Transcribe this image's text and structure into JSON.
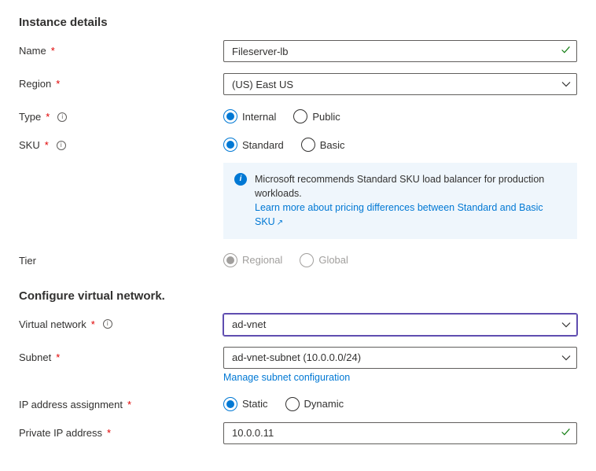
{
  "sections": {
    "instance": "Instance details",
    "vnet": "Configure virtual network."
  },
  "labels": {
    "name": "Name",
    "region": "Region",
    "type": "Type",
    "sku": "SKU",
    "tier": "Tier",
    "virtual_network": "Virtual network",
    "subnet": "Subnet",
    "ip_assignment": "IP address assignment",
    "private_ip": "Private IP address"
  },
  "values": {
    "name": "Fileserver-lb",
    "region": "(US) East US",
    "virtual_network": "ad-vnet",
    "subnet": "ad-vnet-subnet (10.0.0.0/24)",
    "private_ip": "10.0.0.11"
  },
  "radios": {
    "type": {
      "internal": "Internal",
      "public": "Public"
    },
    "sku": {
      "standard": "Standard",
      "basic": "Basic"
    },
    "tier": {
      "regional": "Regional",
      "global": "Global"
    },
    "ip": {
      "static": "Static",
      "dynamic": "Dynamic"
    }
  },
  "info": {
    "text": "Microsoft recommends Standard SKU load balancer for production workloads.",
    "link": "Learn more about pricing differences between Standard and Basic SKU"
  },
  "links": {
    "manage_subnet": "Manage subnet configuration"
  }
}
